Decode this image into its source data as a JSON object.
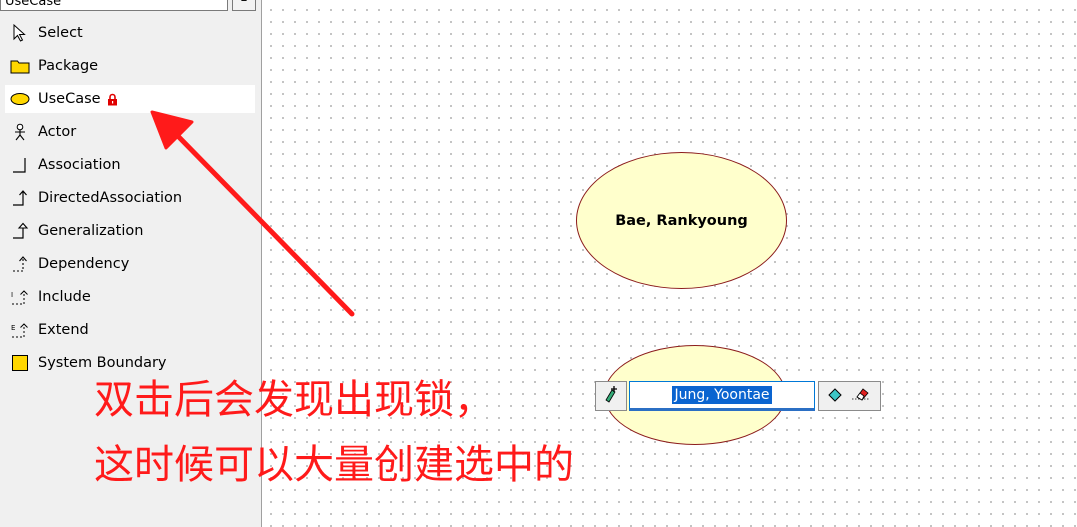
{
  "palette": {
    "header": "UseCase",
    "collapse_glyph": "–",
    "items": [
      {
        "label": "Select",
        "icon": "select-cursor-icon"
      },
      {
        "label": "Package",
        "icon": "package-folder-icon"
      },
      {
        "label": "UseCase",
        "icon": "usecase-ellipse-icon",
        "selected": true,
        "locked": true
      },
      {
        "label": "Actor",
        "icon": "actor-icon"
      },
      {
        "label": "Association",
        "icon": "association-icon"
      },
      {
        "label": "DirectedAssociation",
        "icon": "directed-association-icon"
      },
      {
        "label": "Generalization",
        "icon": "generalization-icon"
      },
      {
        "label": "Dependency",
        "icon": "dependency-icon"
      },
      {
        "label": "Include",
        "icon": "include-icon"
      },
      {
        "label": "Extend",
        "icon": "extend-icon"
      },
      {
        "label": "System Boundary",
        "icon": "system-boundary-icon"
      }
    ]
  },
  "canvas": {
    "usecases": [
      {
        "label": "Bae, Rankyoung"
      },
      {
        "label": "Jung, Yoontae",
        "editing": true
      }
    ],
    "editor_value": "Jung, Yoontae"
  },
  "annotation": {
    "line1": "双击后会发现出现锁，",
    "line2": "这时候可以大量创建选中的",
    "color": "#ff1a1a"
  },
  "colors": {
    "usecase_fill": "#ffffcc",
    "usecase_border": "#8b1c1c",
    "selection": "#0a64d0"
  }
}
